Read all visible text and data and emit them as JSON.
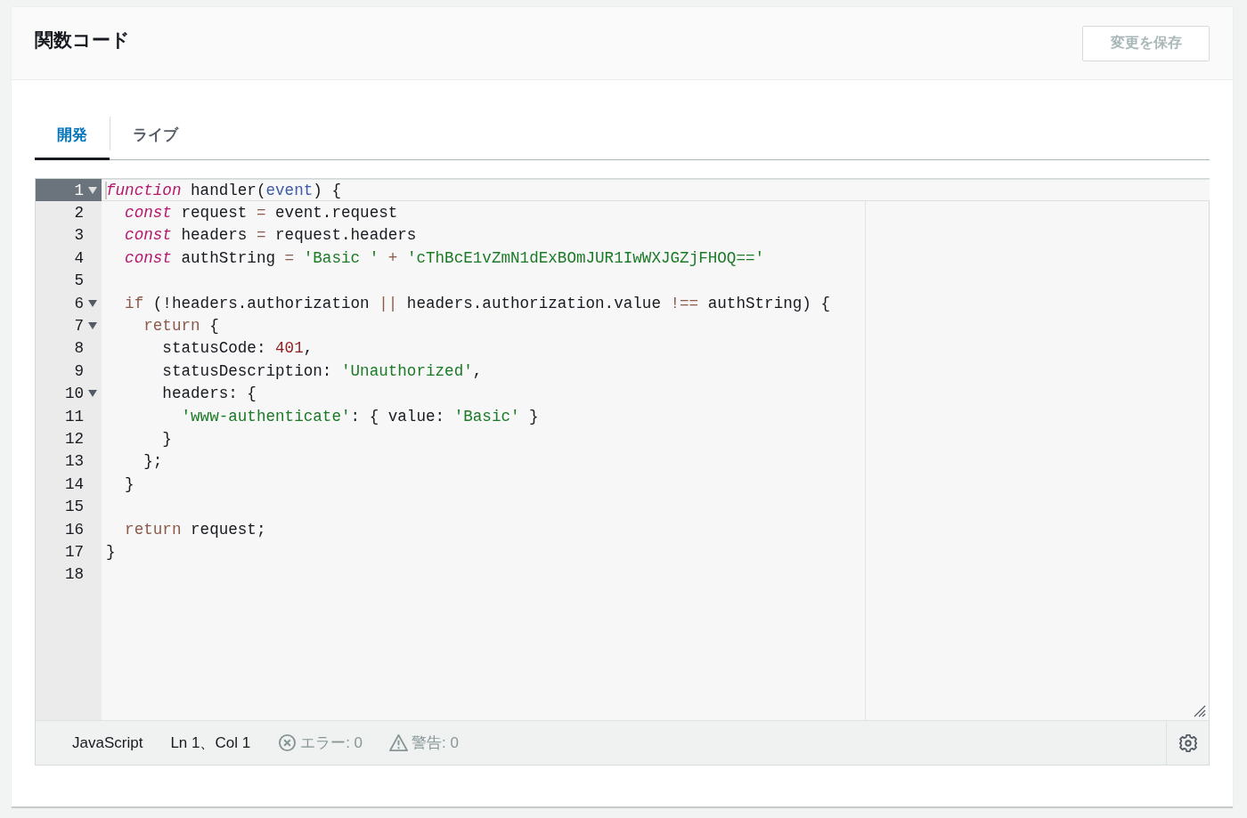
{
  "panel": {
    "title": "関数コード",
    "save_button": {
      "label": "変更を保存",
      "disabled": true
    }
  },
  "tabs": [
    {
      "label": "開発",
      "selected": true
    },
    {
      "label": "ライブ",
      "selected": false
    }
  ],
  "editor": {
    "lines": [
      {
        "number": "1",
        "foldable": true,
        "active": true,
        "tokens": [
          {
            "kind": "keyword",
            "text": "function"
          },
          {
            "kind": "plain",
            "text": " handler("
          },
          {
            "kind": "param",
            "text": "event"
          },
          {
            "kind": "plain",
            "text": ") {"
          }
        ]
      },
      {
        "number": "2",
        "foldable": false,
        "active": false,
        "tokens": [
          {
            "kind": "keyword",
            "text": "  const"
          },
          {
            "kind": "plain",
            "text": " request "
          },
          {
            "kind": "operator",
            "text": "="
          },
          {
            "kind": "plain",
            "text": " event.request"
          }
        ]
      },
      {
        "number": "3",
        "foldable": false,
        "active": false,
        "tokens": [
          {
            "kind": "keyword",
            "text": "  const"
          },
          {
            "kind": "plain",
            "text": " headers "
          },
          {
            "kind": "operator",
            "text": "="
          },
          {
            "kind": "plain",
            "text": " request.headers"
          }
        ]
      },
      {
        "number": "4",
        "foldable": false,
        "active": false,
        "tokens": [
          {
            "kind": "keyword",
            "text": "  const"
          },
          {
            "kind": "plain",
            "text": " authString "
          },
          {
            "kind": "operator",
            "text": "="
          },
          {
            "kind": "string",
            "text": " 'Basic '"
          },
          {
            "kind": "operator",
            "text": " + "
          },
          {
            "kind": "string",
            "text": "'cThBcE1vZmN1dExBOmJUR1IwWXJGZjFHOQ=='"
          }
        ]
      },
      {
        "number": "5",
        "foldable": false,
        "active": false
      },
      {
        "number": "6",
        "foldable": true,
        "active": false,
        "tokens": [
          {
            "kind": "control",
            "text": "  if"
          },
          {
            "kind": "plain",
            "text": " (!headers.authorization "
          },
          {
            "kind": "operator",
            "text": "||"
          },
          {
            "kind": "plain",
            "text": " headers.authorization.value "
          },
          {
            "kind": "operator",
            "text": "!=="
          },
          {
            "kind": "plain",
            "text": " authString) {"
          }
        ]
      },
      {
        "number": "7",
        "foldable": true,
        "active": false,
        "tokens": [
          {
            "kind": "control",
            "text": "    return"
          },
          {
            "kind": "plain",
            "text": " {"
          }
        ]
      },
      {
        "number": "8",
        "foldable": false,
        "active": false,
        "tokens": [
          {
            "kind": "plain",
            "text": "      statusCode: "
          },
          {
            "kind": "number",
            "text": "401"
          },
          {
            "kind": "plain",
            "text": ","
          }
        ]
      },
      {
        "number": "9",
        "foldable": false,
        "active": false,
        "tokens": [
          {
            "kind": "plain",
            "text": "      statusDescription: "
          },
          {
            "kind": "string",
            "text": "'Unauthorized'"
          },
          {
            "kind": "plain",
            "text": ","
          }
        ]
      },
      {
        "number": "10",
        "foldable": true,
        "active": false,
        "tokens": [
          {
            "kind": "plain",
            "text": "      headers: {"
          }
        ]
      },
      {
        "number": "11",
        "foldable": false,
        "active": false,
        "tokens": [
          {
            "kind": "string",
            "text": "        'www-authenticate'"
          },
          {
            "kind": "plain",
            "text": ": { value: "
          },
          {
            "kind": "string",
            "text": "'Basic'"
          },
          {
            "kind": "plain",
            "text": " }"
          }
        ]
      },
      {
        "number": "12",
        "foldable": false,
        "active": false,
        "tokens": [
          {
            "kind": "plain",
            "text": "      }"
          }
        ]
      },
      {
        "number": "13",
        "foldable": false,
        "active": false,
        "tokens": [
          {
            "kind": "plain",
            "text": "    };"
          }
        ]
      },
      {
        "number": "14",
        "foldable": false,
        "active": false,
        "tokens": [
          {
            "kind": "plain",
            "text": "  }"
          }
        ]
      },
      {
        "number": "15",
        "foldable": false,
        "active": false
      },
      {
        "number": "16",
        "foldable": false,
        "active": false,
        "tokens": [
          {
            "kind": "control",
            "text": "  return"
          },
          {
            "kind": "plain",
            "text": " request;"
          }
        ]
      },
      {
        "number": "17",
        "foldable": false,
        "active": false,
        "tokens": [
          {
            "kind": "plain",
            "text": "}"
          }
        ]
      },
      {
        "number": "18",
        "foldable": false,
        "active": false
      }
    ]
  },
  "status_bar": {
    "language": "JavaScript",
    "position": "Ln 1、Col 1",
    "errors": "エラー: 0",
    "warnings": "警告: 0"
  }
}
